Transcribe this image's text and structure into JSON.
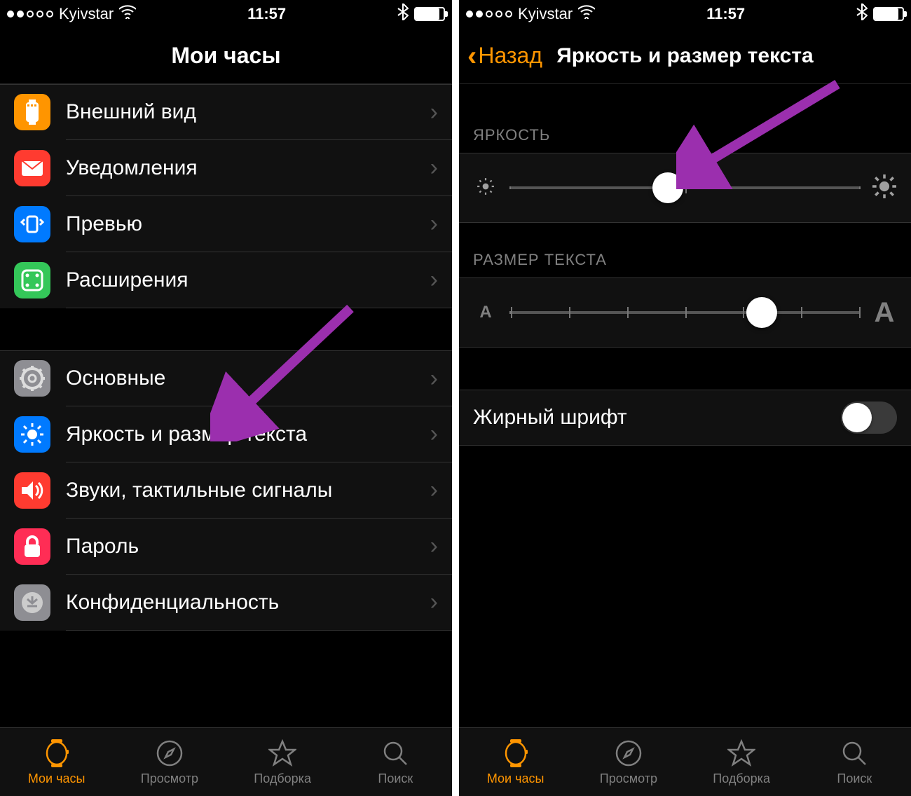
{
  "status": {
    "carrier": "Kyivstar",
    "time": "11:57",
    "signal_dots": 5,
    "signal_filled": 2
  },
  "left_screen": {
    "title": "Мои часы",
    "group1": [
      {
        "label": "Внешний вид",
        "icon": "appearance-icon",
        "color": "#ff9500"
      },
      {
        "label": "Уведомления",
        "icon": "notifications-icon",
        "color": "#ff3b30"
      },
      {
        "label": "Превью",
        "icon": "preview-icon",
        "color": "#007aff"
      },
      {
        "label": "Расширения",
        "icon": "extensions-icon",
        "color": "#34c759"
      }
    ],
    "group2": [
      {
        "label": "Основные",
        "icon": "general-icon",
        "color": "#8e8e93"
      },
      {
        "label": "Яркость и размер текста",
        "icon": "brightness-icon",
        "color": "#007aff"
      },
      {
        "label": "Звуки, тактильные сигналы",
        "icon": "sounds-icon",
        "color": "#ff3b30"
      },
      {
        "label": "Пароль",
        "icon": "password-icon",
        "color": "#ff2d55"
      },
      {
        "label": "Конфиденциальность",
        "icon": "privacy-icon",
        "color": "#8e8e93"
      }
    ]
  },
  "right_screen": {
    "back_label": "Назад",
    "title": "Яркость и размер текста",
    "brightness_label": "ЯРКОСТЬ",
    "brightness_value": 45,
    "textsize_label": "РАЗМЕР ТЕКСТА",
    "textsize_value": 72,
    "textsize_steps": 7,
    "bold_label": "Жирный шрифт",
    "bold_on": false
  },
  "tabs": [
    {
      "label": "Мои часы",
      "icon": "watch-icon",
      "active": true
    },
    {
      "label": "Просмотр",
      "icon": "browse-icon",
      "active": false
    },
    {
      "label": "Подборка",
      "icon": "featured-icon",
      "active": false
    },
    {
      "label": "Поиск",
      "icon": "search-icon",
      "active": false
    }
  ],
  "colors": {
    "accent": "#ff9500",
    "arrow": "#9b2fae"
  }
}
